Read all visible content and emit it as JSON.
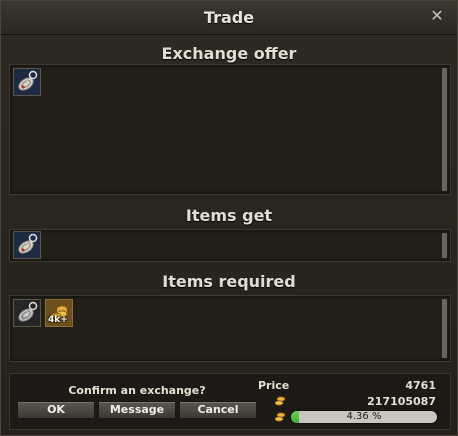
{
  "window": {
    "title": "Trade",
    "close_glyph": "✕"
  },
  "sections": {
    "exchange_offer": {
      "title": "Exchange offer",
      "items": [
        {
          "icon": "scroll-bundle-icon"
        }
      ]
    },
    "items_get": {
      "title": "Items get",
      "items": [
        {
          "icon": "scroll-bundle-icon"
        }
      ]
    },
    "items_required": {
      "title": "Items required",
      "items": [
        {
          "icon": "scroll-bundle-grey-icon"
        },
        {
          "icon": "gold-coins-icon",
          "label": "4k+"
        }
      ]
    }
  },
  "footer": {
    "confirm_text": "Confirm an exchange?",
    "buttons": {
      "ok": "OK",
      "message": "Message",
      "cancel": "Cancel"
    },
    "price_label": "Price",
    "price_value": "4761",
    "gold_amount": "217105087",
    "progress_text": "4.36 %",
    "progress_fraction": 0.0436
  },
  "colors": {
    "progress_fill": "#3fae30",
    "slot_blue": "#1e2a40",
    "slot_gold": "#7a5a22"
  }
}
